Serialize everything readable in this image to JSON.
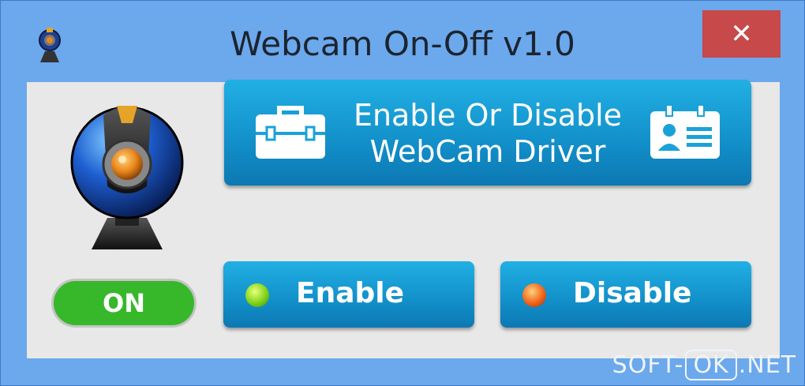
{
  "window": {
    "title": "Webcam On-Off v1.0",
    "close_label": "✕"
  },
  "status": {
    "label": "ON",
    "color": "#37b82b"
  },
  "main_button": {
    "line1": "Enable Or Disable",
    "line2": "WebCam Driver"
  },
  "enable_button": {
    "label": "Enable",
    "led_color": "#7fd21a"
  },
  "disable_button": {
    "label": "Disable",
    "led_color": "#f0651a"
  },
  "watermark": {
    "prefix": "SOFT-",
    "boxed": "OK",
    "suffix": ".NET"
  },
  "colors": {
    "window_frame": "#6ca8ec",
    "client_bg": "#e8e8e8",
    "button_blue": "#128fc9",
    "close_red": "#c7494a"
  }
}
